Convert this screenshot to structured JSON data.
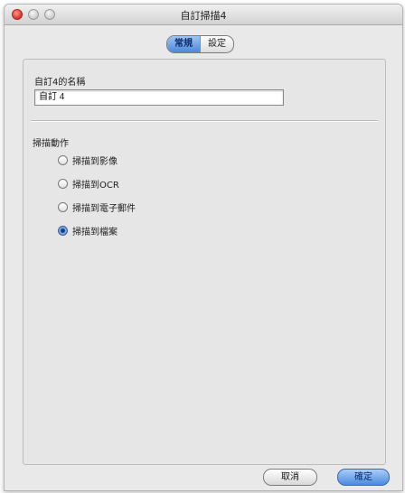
{
  "window": {
    "title": "自訂掃描4"
  },
  "tabs": [
    {
      "label": "常規",
      "active": true
    },
    {
      "label": "設定",
      "active": false
    }
  ],
  "name_section": {
    "label": "自訂4的名稱",
    "value": "自訂 4"
  },
  "scan_section": {
    "label": "掃描動作",
    "options": [
      {
        "label": "掃描到影像",
        "selected": false
      },
      {
        "label": "掃描到OCR",
        "selected": false
      },
      {
        "label": "掃描到電子郵件",
        "selected": false
      },
      {
        "label": "掃描到檔案",
        "selected": true
      }
    ]
  },
  "buttons": {
    "cancel": "取消",
    "ok": "確定"
  },
  "colors": {
    "accent": "#4a88dc",
    "window_bg": "#e9e9e9",
    "close_button": "#d9302a"
  }
}
